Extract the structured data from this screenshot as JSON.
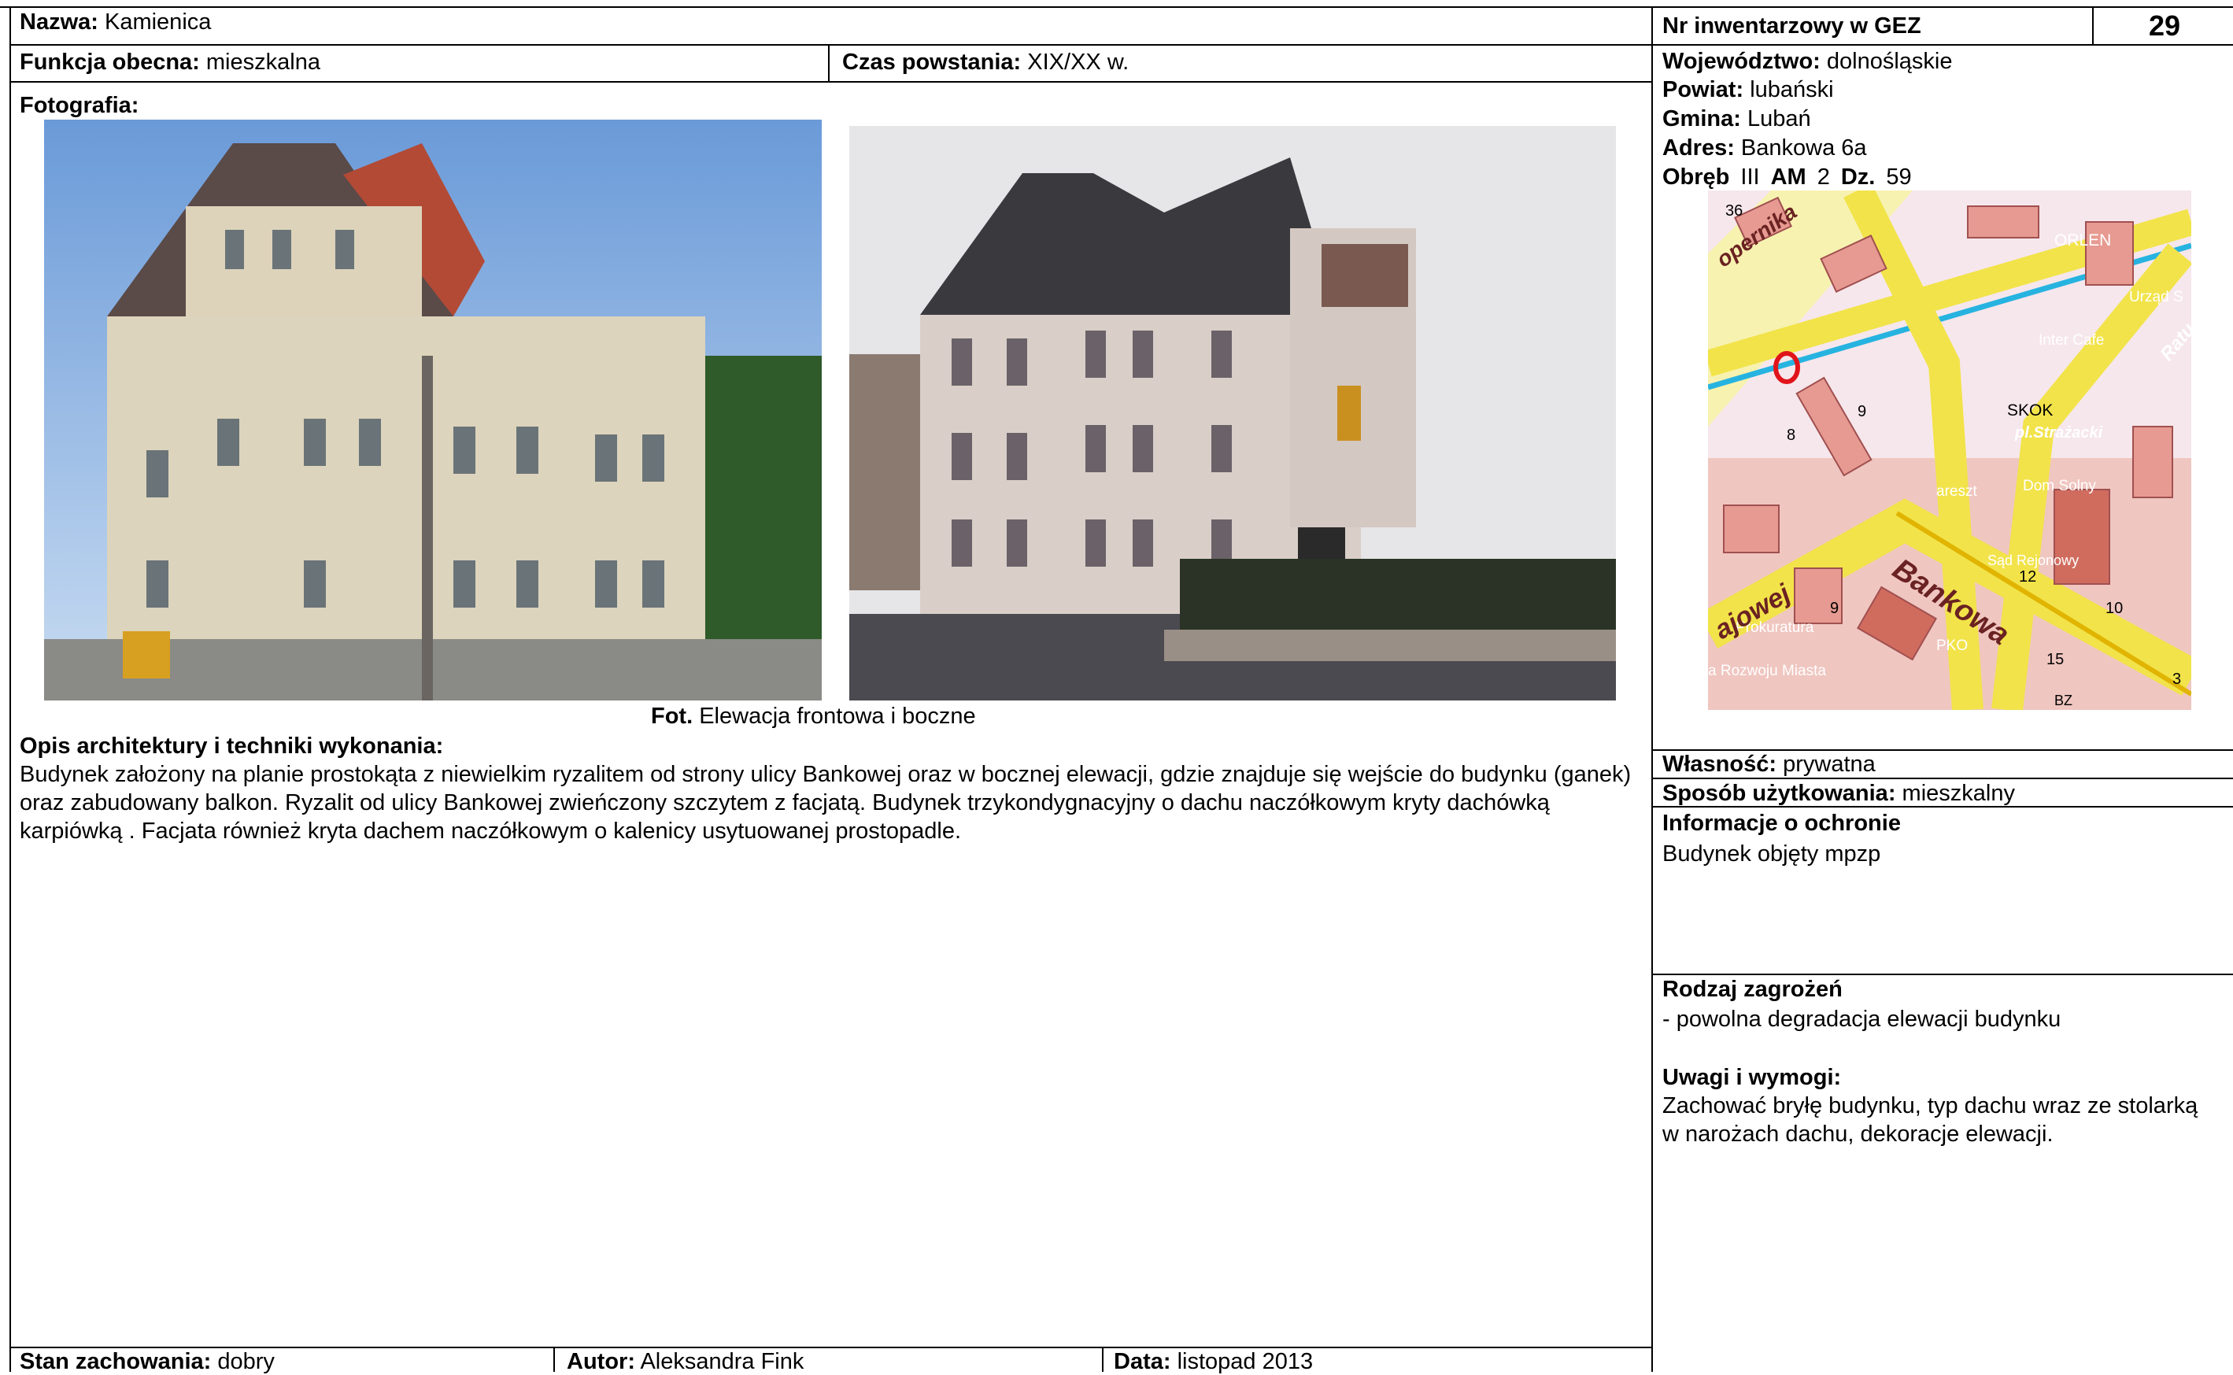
{
  "header": {
    "nazwa_label": "Nazwa:",
    "nazwa_value": "Kamienica",
    "nr_label": "Nr inwentarzowy w GEZ",
    "nr_value": "29"
  },
  "row2": {
    "funkcja_label": "Funkcja obecna:",
    "funkcja_value": "mieszkalna",
    "czas_label": "Czas powstania:",
    "czas_value": "XIX/XX w."
  },
  "location": {
    "wojewodztwo_label": "Województwo:",
    "wojewodztwo_value": "dolnośląskie",
    "powiat_label": "Powiat:",
    "powiat_value": "lubański",
    "gmina_label": "Gmina:",
    "gmina_value": "Lubań",
    "adres_label": "Adres:",
    "adres_value": "Bankowa 6a",
    "obreb_label": "Obręb",
    "obreb_value": "III",
    "am_label": "AM",
    "am_value": "2",
    "dz_label": "Dz.",
    "dz_value": "59"
  },
  "photo_section": {
    "label": "Fotografia:",
    "caption_label": "Fot.",
    "caption_text": "Elewacja frontowa i boczne"
  },
  "map": {
    "labels": {
      "orlen": "ORLEN",
      "urzad": "Urząd S",
      "intercafe": "Inter Cafe",
      "skok": "SKOK",
      "strazacki": "pl.Strażacki",
      "areszt": "areszt",
      "domsolny": "Dom Solny",
      "bankowa": "Bankowa",
      "sad": "Sąd Rejonowy",
      "prokuratura": "Prokuratura",
      "pko": "PKO",
      "rozwoju": "a Rozwoju Miasta",
      "ajowej": "ajowej",
      "kopernika": "opernika",
      "ratusz": "Ratu",
      "n36": "36",
      "n8": "8",
      "n9": "9",
      "n9b": "9",
      "n10": "10",
      "n12": "12",
      "n15": "15",
      "n3": "3",
      "bz": "BZ"
    }
  },
  "opis": {
    "label": "Opis architektury i techniki wykonania:",
    "text": "Budynek założony na planie prostokąta z niewielkim ryzalitem od strony ulicy Bankowej oraz w bocznej elewacji, gdzie znajduje się wejście do budynku (ganek) oraz zabudowany balkon. Ryzalit od ulicy Bankowej zwieńczony szczytem z facjatą. Budynek  trzykondygnacyjny o dachu naczółkowym kryty dachówką karpiówką . Facjata również kryta dachem naczółkowym o kalenicy usytuowanej prostopadle."
  },
  "right": {
    "wlasnosc_label": "Własność:",
    "wlasnosc_value": "prywatna",
    "sposob_label": "Sposób użytkowania:",
    "sposob_value": "mieszkalny",
    "ochrona_label": "Informacje o ochronie",
    "ochrona_text": "Budynek objęty mpzp",
    "zagrozenia_label": "Rodzaj zagrożeń",
    "zagrozenia_text": "- powolna degradacja elewacji budynku",
    "uwagi_label": "Uwagi i wymogi:",
    "uwagi_text": "Zachować bryłę budynku, typ dachu wraz ze stolarką w narożach dachu, dekoracje elewacji."
  },
  "footer": {
    "stan_label": "Stan zachowania:",
    "stan_value": "dobry",
    "autor_label": "Autor:",
    "autor_value": "Aleksandra Fink",
    "data_label": "Data:",
    "data_value": "listopad 2013"
  },
  "colors": {
    "map_background": "#f5d3cf",
    "map_road": "#f2e34a",
    "map_water": "#27b3e0"
  }
}
